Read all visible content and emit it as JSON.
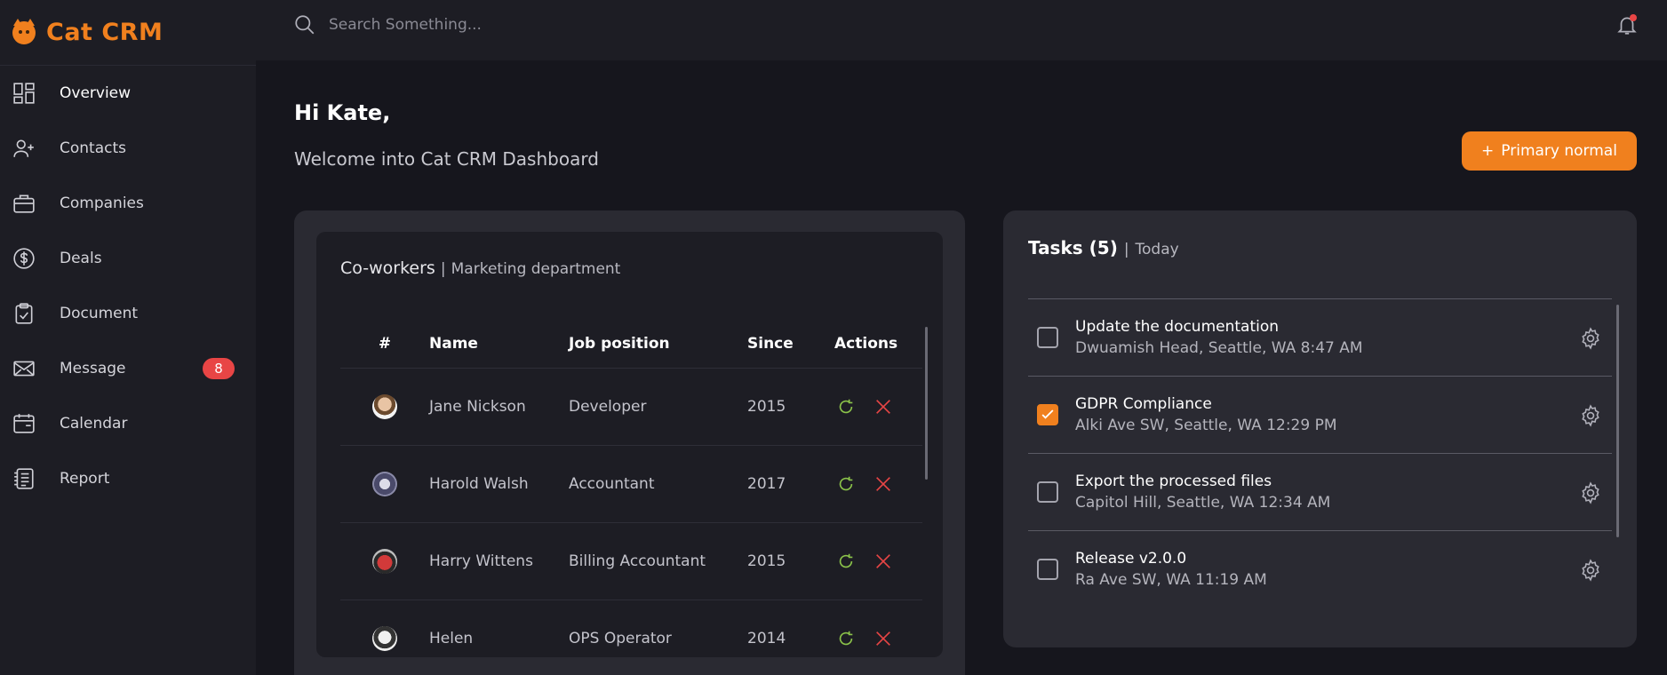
{
  "app": {
    "name": "Cat CRM"
  },
  "sidebar": {
    "items": [
      {
        "label": "Overview",
        "icon": "grid-icon",
        "active": true
      },
      {
        "label": "Contacts",
        "icon": "add-user-icon"
      },
      {
        "label": "Companies",
        "icon": "briefcase-icon"
      },
      {
        "label": "Deals",
        "icon": "dollar-icon"
      },
      {
        "label": "Document",
        "icon": "clipboard-icon"
      },
      {
        "label": "Message",
        "icon": "mail-icon",
        "badge": "8"
      },
      {
        "label": "Calendar",
        "icon": "calendar-icon"
      },
      {
        "label": "Report",
        "icon": "report-icon"
      }
    ]
  },
  "topbar": {
    "search_placeholder": "Search Something..."
  },
  "main": {
    "greeting": "Hi Kate,",
    "welcome": "Welcome into Cat CRM Dashboard",
    "primary_button": "Primary normal"
  },
  "coworkers": {
    "title": "Co-workers",
    "subtitle": "Marketing department",
    "columns": [
      "#",
      "Name",
      "Job position",
      "Since",
      "Actions"
    ],
    "rows": [
      {
        "name": "Jane Nickson",
        "job": "Developer",
        "since": "2015"
      },
      {
        "name": "Harold Walsh",
        "job": "Accountant",
        "since": "2017"
      },
      {
        "name": "Harry Wittens",
        "job": "Billing Accountant",
        "since": "2015"
      },
      {
        "name": "Helen",
        "job": "OPS Operator",
        "since": "2014"
      }
    ]
  },
  "tasks": {
    "title": "Tasks (5)",
    "subtitle": "Today",
    "items": [
      {
        "name": "Update the documentation",
        "meta": "Dwuamish Head, Seattle, WA 8:47 AM",
        "checked": false
      },
      {
        "name": "GDPR Compliance",
        "meta": "Alki Ave SW, Seattle, WA 12:29 PM",
        "checked": true
      },
      {
        "name": "Export the processed files",
        "meta": "Capitol Hill, Seattle, WA 12:34 AM",
        "checked": false
      },
      {
        "name": "Release v2.0.0",
        "meta": "Ra Ave SW, WA 11:19 AM",
        "checked": false
      }
    ]
  },
  "colors": {
    "accent": "#f0801e",
    "danger": "#e84545",
    "success": "#8bc34a"
  }
}
